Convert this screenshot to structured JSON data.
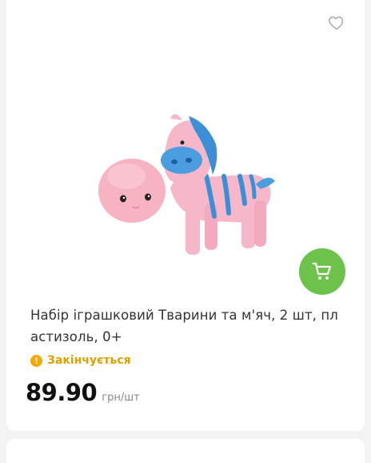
{
  "product": {
    "title": "Набір іграшковий Тварини та м'яч, 2 шт, пл астизоль, 0+",
    "status": "Закінчується",
    "status_icon": "!",
    "price": "89.90",
    "unit": "грн/шт",
    "image_alt": "pink-zebra-toy-and-pink-ball"
  },
  "icons": {
    "favorite": "heart-outline-icon",
    "cart": "shopping-cart-icon",
    "status": "warning-icon"
  },
  "colors": {
    "accent_green": "#6cc24a",
    "status_orange": "#f5a800",
    "zebra_pink": "#f6b8c8",
    "zebra_blue": "#3a8fd6"
  }
}
